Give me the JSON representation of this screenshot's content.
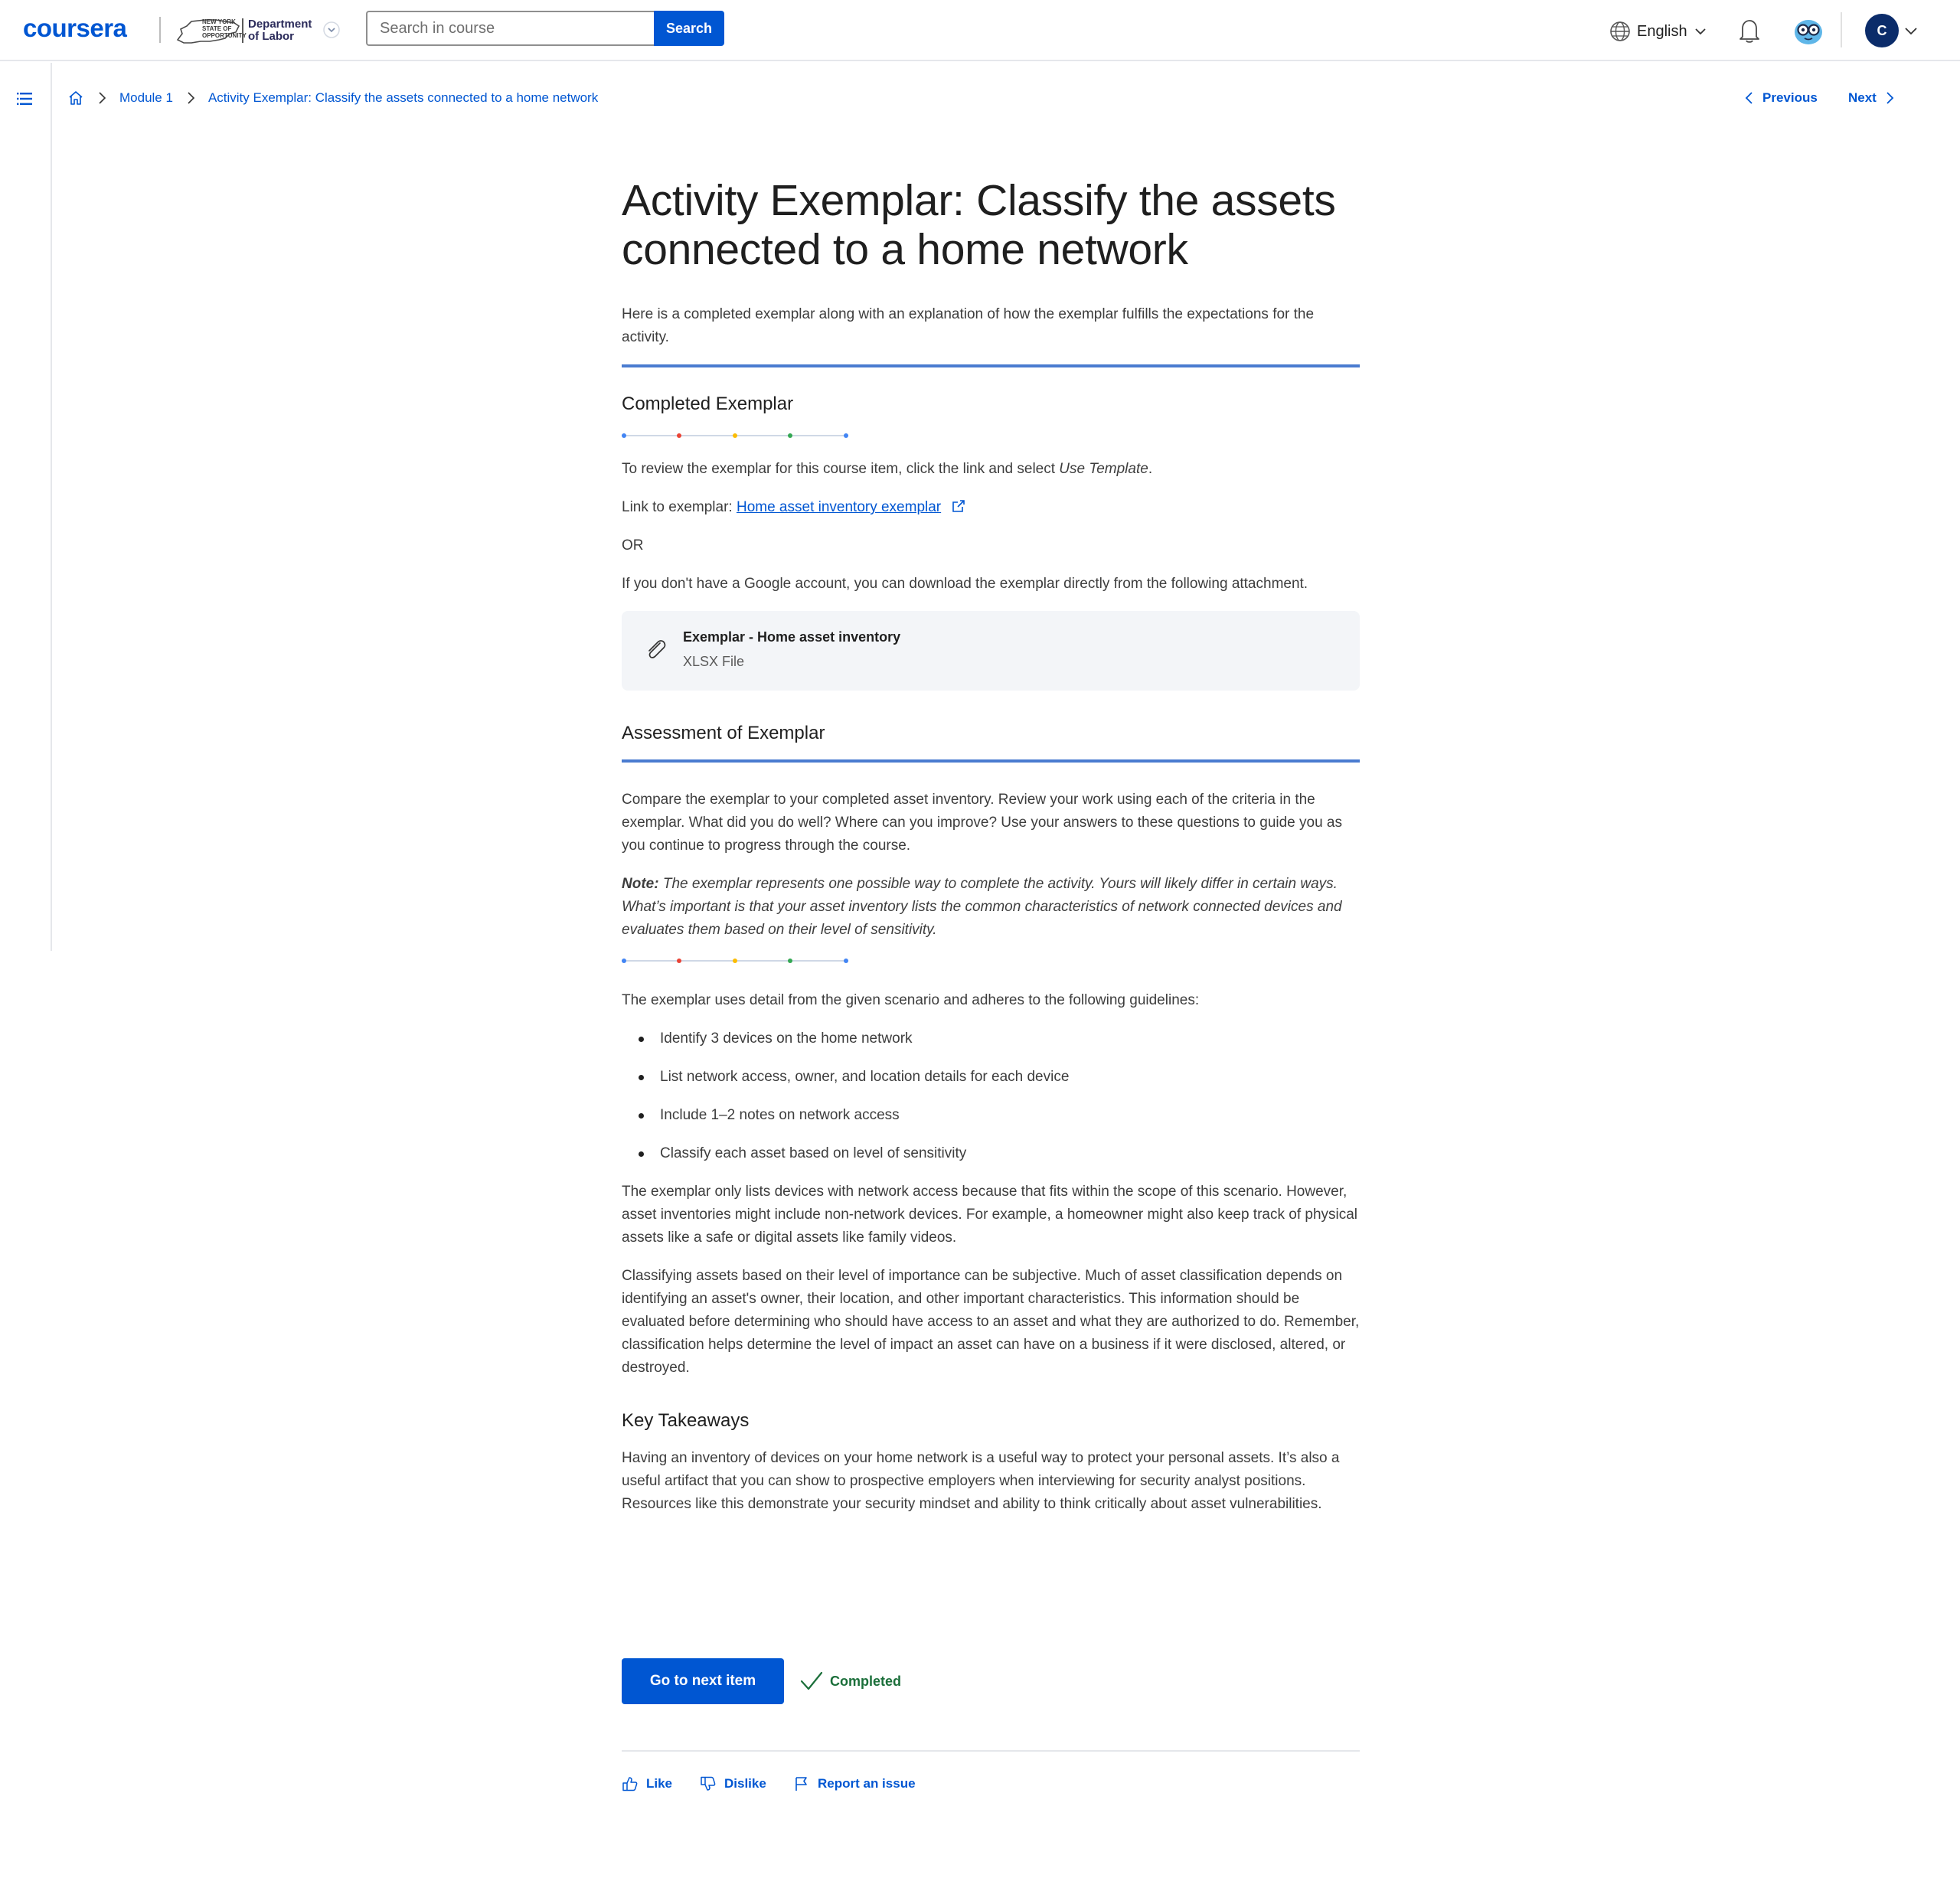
{
  "header": {
    "logo": "coursera",
    "partner": {
      "seal_text": "NEW YORK STATE OF OPPORTUNITY",
      "line1": "Department",
      "line2": "of Labor"
    },
    "search_placeholder": "Search in course",
    "search_button": "Search",
    "language": "English",
    "avatar_initial": "C"
  },
  "breadcrumb": {
    "module": "Module 1",
    "current": "Activity Exemplar: Classify the assets connected to a home network"
  },
  "nav": {
    "previous": "Previous",
    "next": "Next"
  },
  "page": {
    "title": "Activity Exemplar: Classify the assets connected to a home network",
    "intro": "Here is a completed exemplar along with an explanation of how the exemplar fulfills the expectations for the activity.",
    "completed_heading": "Completed Exemplar",
    "review_text": "To review the exemplar for this course item, click the link and select ",
    "review_em": "Use Template",
    "review_end": ".",
    "link_label": "Link to exemplar: ",
    "link_text": "Home asset inventory exemplar",
    "or": "OR",
    "no_google": "If you don't have a Google account, you can download the exemplar directly from the following attachment.",
    "attachment": {
      "name": "Exemplar - Home asset inventory",
      "type": "XLSX File"
    },
    "assessment_heading": "Assessment of Exemplar",
    "compare": "Compare the exemplar to your completed asset inventory. Review your work using each of the criteria in the exemplar. What did you do well? Where can you improve? Use your answers to these questions to guide you as you continue to progress through the course.",
    "note_label": "Note:",
    "note_text": " The exemplar represents one possible way to complete the activity. Yours will likely differ in certain ways. What’s important is that your asset inventory lists the common characteristics of network connected devices and evaluates them based on their level of sensitivity.",
    "guidelines_intro": "The exemplar uses detail from the given scenario and adheres to the following guidelines:",
    "guidelines": [
      "Identify 3 devices on the home network",
      "List network access, owner, and location details for each device",
      "Include 1–2 notes on network access",
      "Classify each asset based on level of sensitivity"
    ],
    "scope": "The exemplar only lists devices with network access because that fits within the scope of this scenario. However, asset inventories might include non-network devices. For example, a homeowner might also keep track of physical assets like a safe or digital assets like family videos.",
    "classifying": "Classifying assets based on their level of importance can be subjective. Much of asset classification depends on identifying an asset's owner, their location, and other important characteristics. This information should be evaluated before determining who should have access to an asset and what they are authorized to do. Remember, classification helps determine the level of impact an asset can have on a business if it were disclosed, altered, or destroyed.",
    "takeaways_heading": "Key Takeaways",
    "takeaways": "Having an inventory of devices on your home network is a useful way to protect your personal assets. It’s also a useful artifact that you can show to prospective employers when interviewing for security analyst positions. Resources like this demonstrate your security mindset and ability to think critically about asset vulnerabilities."
  },
  "footer": {
    "next_button": "Go to next item",
    "completed": "Completed",
    "like": "Like",
    "dislike": "Dislike",
    "report": "Report an issue"
  },
  "colors": {
    "brand": "#0056d2",
    "rule": "#4a7bd0",
    "completed": "#1b6f3a",
    "dots": [
      "#4285f4",
      "#ea4335",
      "#fbbc04",
      "#34a853",
      "#4285f4"
    ]
  }
}
